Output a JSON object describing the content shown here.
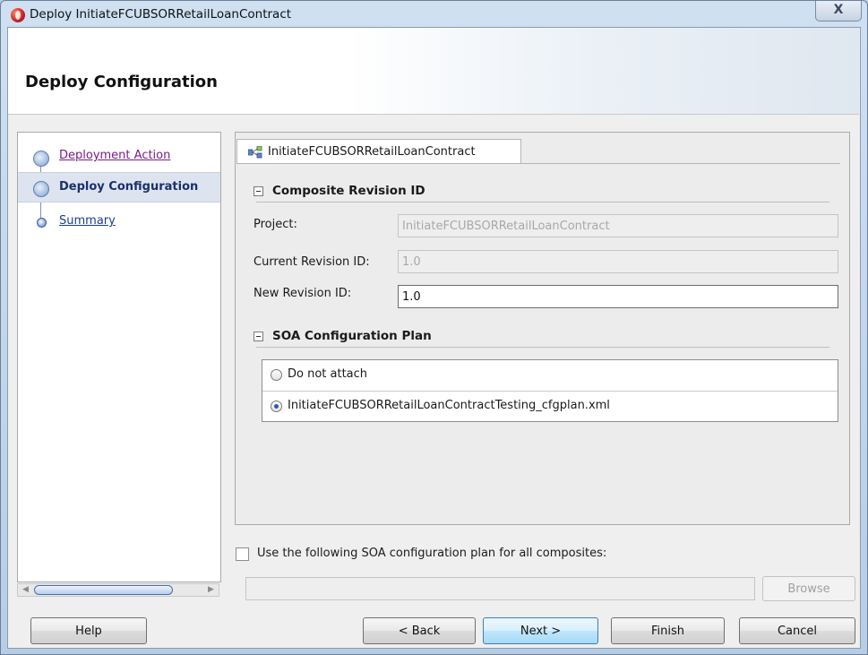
{
  "window": {
    "title": "Deploy InitiateFCUBSORRetailLoanContract",
    "close_glyph": "X"
  },
  "header": {
    "title": "Deploy Configuration"
  },
  "sidebar": {
    "steps": [
      {
        "label": "Deployment Action",
        "state": "visited"
      },
      {
        "label": "Deploy Configuration",
        "state": "current"
      },
      {
        "label": "Summary",
        "state": "link"
      }
    ]
  },
  "tab": {
    "label": "InitiateFCUBSORRetailLoanContract"
  },
  "composite_section": {
    "title": "Composite Revision ID",
    "project_label": "Project:",
    "project_value": "InitiateFCUBSORRetailLoanContract",
    "current_revision_label": "Current Revision ID:",
    "current_revision_value": "1.0",
    "new_revision_label": "New Revision ID:",
    "new_revision_value": "1.0"
  },
  "soa_section": {
    "title": "SOA Configuration Plan",
    "options": [
      {
        "label": "Do not attach",
        "selected": false
      },
      {
        "label": "InitiateFCUBSORRetailLoanContractTesting_cfgplan.xml",
        "selected": true
      }
    ]
  },
  "use_plan_for_all": {
    "label": "Use the following SOA configuration plan for all composites:",
    "checked": false,
    "path_value": "",
    "browse_label": "Browse"
  },
  "buttons": {
    "help": "Help",
    "back": "< Back",
    "next": "Next >",
    "finish": "Finish",
    "cancel": "Cancel"
  },
  "colors": {
    "visited_link": "#7a1a8a",
    "current_step": "#1b2f6b",
    "link": "#1a3d8f"
  }
}
